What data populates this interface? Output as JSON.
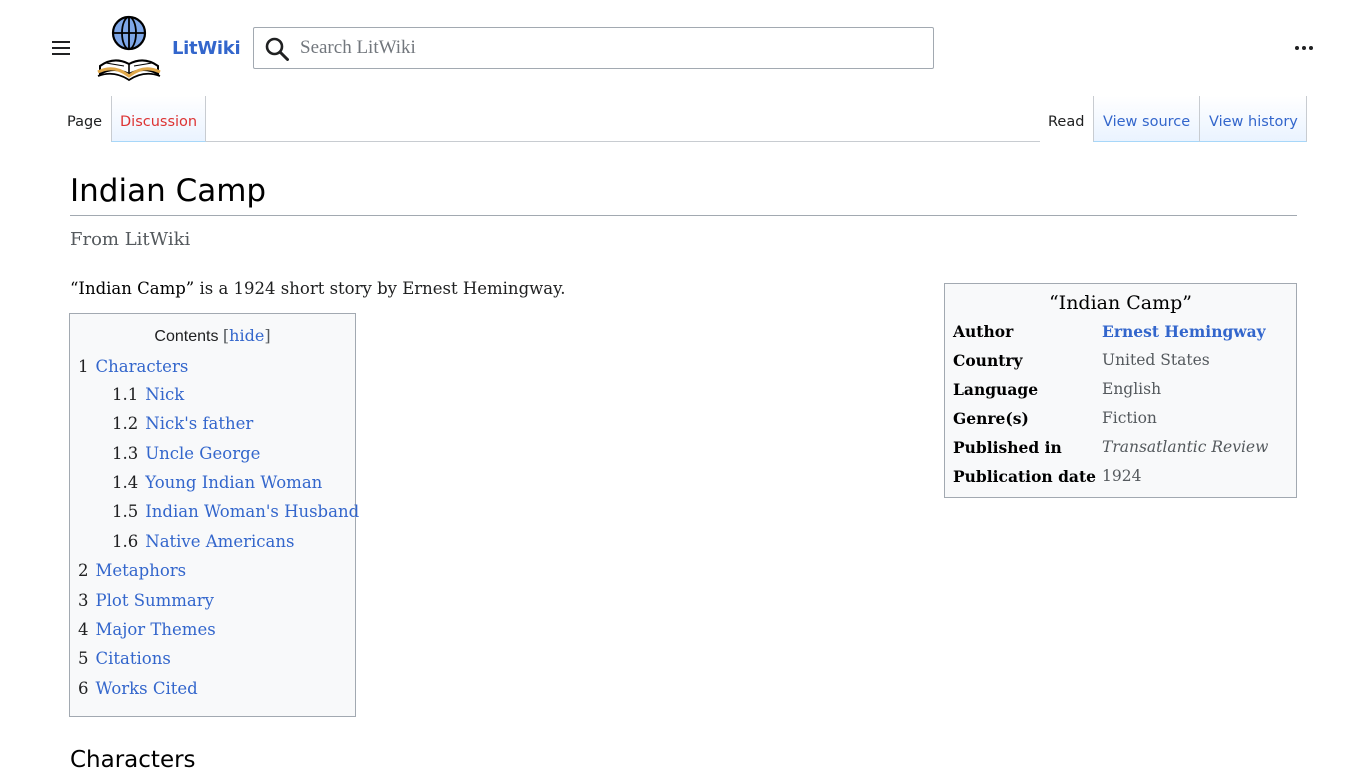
{
  "header": {
    "menu_icon": "hamburger-menu-icon",
    "logo_icon": "globe-book-logo-icon",
    "wordmark": "LitWiki",
    "search_placeholder": "Search LitWiki",
    "search_icon": "search-icon",
    "more_icon": "ellipsis-icon"
  },
  "tabs": {
    "left": [
      {
        "label": "Page",
        "active": true
      },
      {
        "label": "Discussion",
        "active": false
      }
    ],
    "right": [
      {
        "label": "Read",
        "active": true
      },
      {
        "label": "View source",
        "active": false
      },
      {
        "label": "View history",
        "active": false
      }
    ]
  },
  "article": {
    "title": "Indian Camp",
    "tagline": "From LitWiki",
    "lead_bold": "“Indian Camp”",
    "lead_rest": " is a 1924 short story by Ernest Hemingway.",
    "next_section": "Characters"
  },
  "toc": {
    "heading": "Contents",
    "bracket_open": "[",
    "hide_label": "hide",
    "bracket_close": "]",
    "items": [
      {
        "num": "1",
        "text": "Characters",
        "level": 1
      },
      {
        "num": "1.1",
        "text": "Nick",
        "level": 2
      },
      {
        "num": "1.2",
        "text": "Nick's father",
        "level": 2
      },
      {
        "num": "1.3",
        "text": "Uncle George",
        "level": 2
      },
      {
        "num": "1.4",
        "text": "Young Indian Woman",
        "level": 2
      },
      {
        "num": "1.5",
        "text": "Indian Woman's Husband",
        "level": 2
      },
      {
        "num": "1.6",
        "text": "Native Americans",
        "level": 2
      },
      {
        "num": "2",
        "text": "Metaphors",
        "level": 1
      },
      {
        "num": "3",
        "text": "Plot Summary",
        "level": 1
      },
      {
        "num": "4",
        "text": "Major Themes",
        "level": 1
      },
      {
        "num": "5",
        "text": "Citations",
        "level": 1
      },
      {
        "num": "6",
        "text": "Works Cited",
        "level": 1
      }
    ]
  },
  "infobox": {
    "title": "“Indian Camp”",
    "rows": [
      {
        "key": "Author",
        "value": "Ernest Hemingway",
        "link": true
      },
      {
        "key": "Country",
        "value": "United States"
      },
      {
        "key": "Language",
        "value": "English"
      },
      {
        "key": "Genre(s)",
        "value": "Fiction"
      },
      {
        "key": "Published in",
        "value": "Transatlantic Review",
        "italic": true
      },
      {
        "key": "Publication date",
        "value": "1924"
      }
    ]
  },
  "colors": {
    "link": "#3366cc",
    "red_link": "#dd3333",
    "text": "#202122",
    "border": "#a2a9b1"
  }
}
